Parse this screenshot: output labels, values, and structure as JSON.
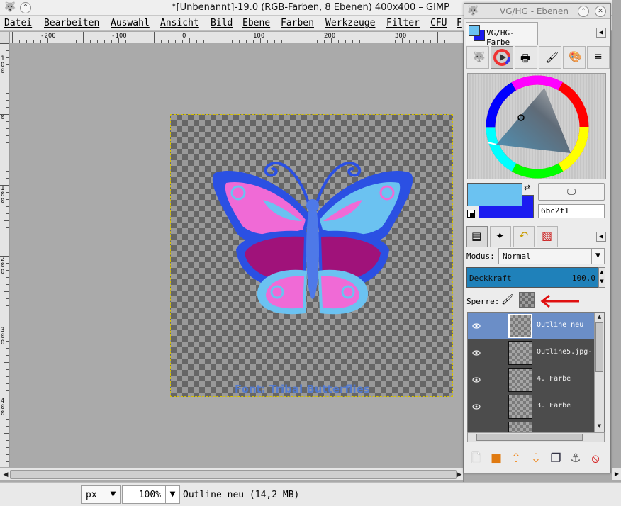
{
  "window": {
    "title": "*[Unbenannt]-19.0 (RGB-Farben, 8 Ebenen) 400x400 – GIMP",
    "minimize_icon": "chevron-up-icon",
    "close_icon": "close-icon"
  },
  "menu": [
    "Datei",
    "Bearbeiten",
    "Auswahl",
    "Ansicht",
    "Bild",
    "Ebene",
    "Farben",
    "Werkzeuge",
    "Filter",
    "CFU",
    "F"
  ],
  "ruler_h_labels": [
    "-200",
    "-100",
    "0",
    "100",
    "200",
    "300",
    "400"
  ],
  "ruler_v_labels": [
    "100",
    "0",
    "100",
    "200",
    "300",
    "400"
  ],
  "canvas": {
    "caption": "Font: Tribal Butterflies",
    "colors": {
      "outline": "#2b50e3",
      "wing_light": "#6bc2f1",
      "wing_pink": "#f06ad6",
      "wing_dark": "#1f2bd8",
      "wing_purple": "#a0127a"
    }
  },
  "statusbar": {
    "unit": "px",
    "zoom": "100%",
    "status": "Outline neu (14,2 MB)"
  },
  "dock": {
    "title": "VG/HG - Ebenen",
    "fgbg_tab_label": "VG/HG-Farbe",
    "fg_color": "#6bc2f1",
    "bg_color": "#1c1cf0",
    "hex_value": "6bc2f1",
    "mode_label": "Modus:",
    "mode_value": "Normal",
    "opacity_label": "Deckkraft",
    "opacity_value": "100,0",
    "lock_label": "Sperre:",
    "layers": [
      {
        "name": "Outline neu",
        "selected": true
      },
      {
        "name": "Outline5.jpg-",
        "selected": false
      },
      {
        "name": "4. Farbe",
        "selected": false
      },
      {
        "name": "3. Farbe",
        "selected": false
      },
      {
        "name": "",
        "selected": false
      }
    ],
    "bottom_buttons": [
      "new-layer-icon",
      "folder-icon",
      "raise-layer-icon",
      "lower-layer-icon",
      "duplicate-layer-icon",
      "anchor-icon",
      "delete-icon"
    ]
  }
}
